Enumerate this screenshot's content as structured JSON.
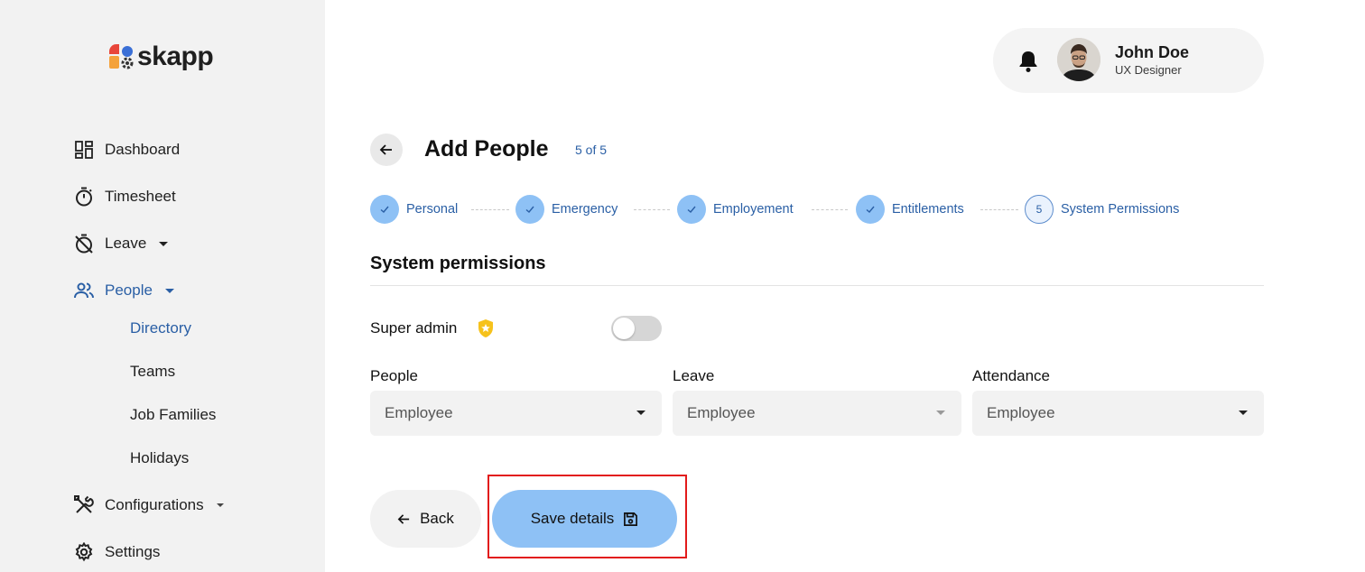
{
  "brand": {
    "name": "skapp"
  },
  "sidebar": {
    "items": [
      {
        "label": "Dashboard",
        "icon": "dashboard-icon"
      },
      {
        "label": "Timesheet",
        "icon": "stopwatch-icon"
      },
      {
        "label": "Leave",
        "icon": "timer-off-icon"
      },
      {
        "label": "People",
        "icon": "people-icon"
      },
      {
        "label": "Configurations",
        "icon": "tools-icon"
      },
      {
        "label": "Settings",
        "icon": "gear-icon"
      }
    ],
    "people_subitems": [
      "Directory",
      "Teams",
      "Job Families",
      "Holidays"
    ]
  },
  "user": {
    "name": "John Doe",
    "role": "UX Designer"
  },
  "page": {
    "title": "Add People",
    "step_count": "5 of 5"
  },
  "stepper": {
    "steps": [
      {
        "label": "Personal",
        "status": "done"
      },
      {
        "label": "Emergency",
        "status": "done"
      },
      {
        "label": "Employement",
        "status": "done"
      },
      {
        "label": "Entitlements",
        "status": "done"
      },
      {
        "label": "System Permissions",
        "status": "current",
        "number": "5"
      }
    ]
  },
  "section": {
    "title": "System permissions"
  },
  "super_admin": {
    "label": "Super admin",
    "enabled": false
  },
  "permissions": [
    {
      "label": "People",
      "value": "Employee"
    },
    {
      "label": "Leave",
      "value": "Employee"
    },
    {
      "label": "Attendance",
      "value": "Employee"
    }
  ],
  "actions": {
    "back_label": "Back",
    "save_label": "Save details"
  },
  "colors": {
    "accent": "#2a5fa5",
    "primary_button": "#8ec1f5",
    "sidebar_bg": "#f2f2f2",
    "highlight": "#e21b1b"
  }
}
